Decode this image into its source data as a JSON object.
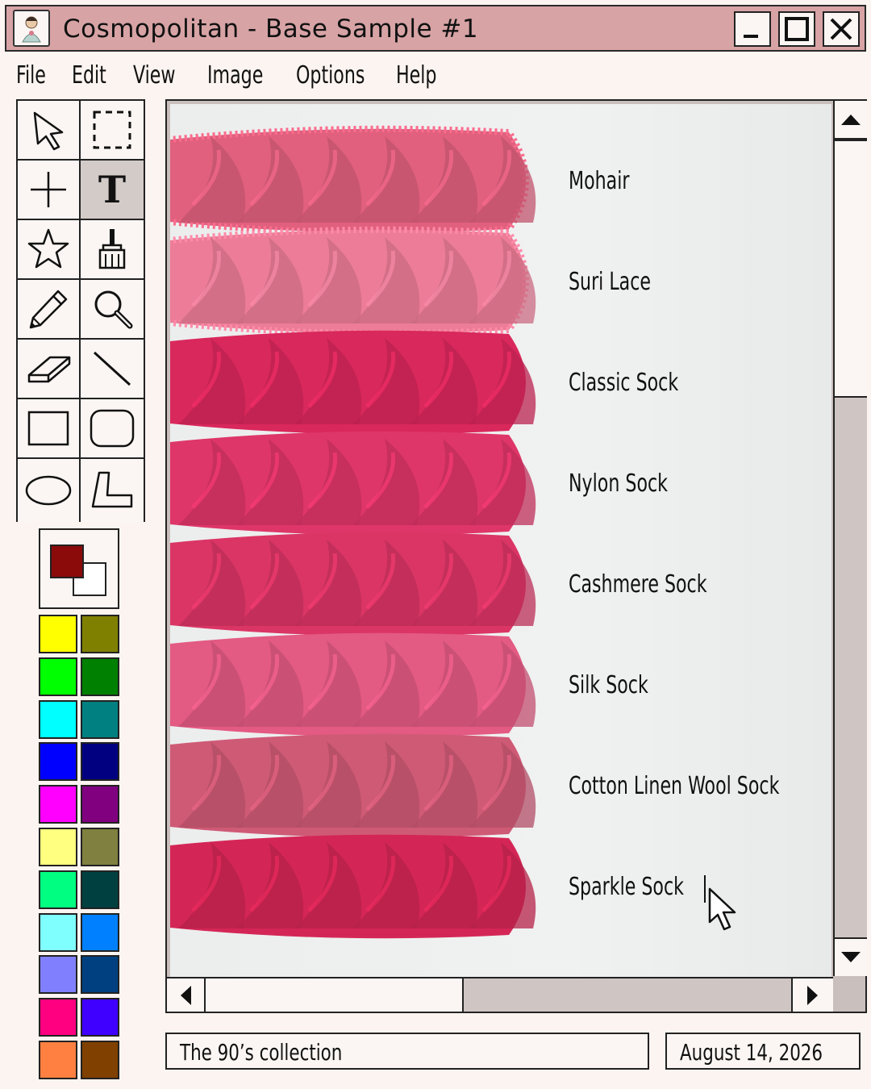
{
  "window": {
    "title": "Cosmopolitan - Base Sample #1",
    "buttons": [
      "minimize",
      "maximize",
      "close"
    ]
  },
  "menu": {
    "items": [
      "File",
      "Edit",
      "View",
      "Image",
      "Options",
      "Help"
    ]
  },
  "toolbox": {
    "tools": [
      {
        "name": "select-arrow",
        "icon": "arrow-cursor-icon"
      },
      {
        "name": "rect-select",
        "icon": "dashed-rectangle-icon"
      },
      {
        "name": "crosshair",
        "icon": "crosshair-icon"
      },
      {
        "name": "text",
        "icon": "text-icon",
        "glyph": "T",
        "active": true
      },
      {
        "name": "star",
        "icon": "star-icon"
      },
      {
        "name": "brush",
        "icon": "brush-icon"
      },
      {
        "name": "pencil",
        "icon": "pencil-icon"
      },
      {
        "name": "magnifier",
        "icon": "magnifier-icon"
      },
      {
        "name": "eraser",
        "icon": "eraser-icon"
      },
      {
        "name": "line",
        "icon": "line-icon"
      },
      {
        "name": "rectangle",
        "icon": "rectangle-icon"
      },
      {
        "name": "rounded-rectangle",
        "icon": "rounded-rectangle-icon"
      },
      {
        "name": "ellipse",
        "icon": "ellipse-icon"
      },
      {
        "name": "polygon",
        "icon": "polygon-icon"
      }
    ]
  },
  "colors": {
    "foreground": "#8b0a0a",
    "background": "#ffffff",
    "palette": [
      "#ffff00",
      "#808000",
      "#00ff00",
      "#008000",
      "#00ffff",
      "#008080",
      "#0000ff",
      "#000080",
      "#ff00ff",
      "#800080",
      "#ffff80",
      "#808040",
      "#00ff80",
      "#004040",
      "#80ffff",
      "#0080ff",
      "#8080ff",
      "#004080",
      "#ff0080",
      "#4000ff",
      "#ff8040",
      "#804000"
    ]
  },
  "canvas": {
    "yarns": [
      {
        "label": "Mohair",
        "color": "#e0607e",
        "fuzzy": true
      },
      {
        "label": "Suri Lace",
        "color": "#ec7c97",
        "fuzzy": true
      },
      {
        "label": "Classic Sock",
        "color": "#d9285c",
        "fuzzy": false
      },
      {
        "label": "Nylon Sock",
        "color": "#de3668",
        "fuzzy": false
      },
      {
        "label": "Cashmere Sock",
        "color": "#da3565",
        "fuzzy": false
      },
      {
        "label": "Silk Sock",
        "color": "#e35a82",
        "fuzzy": false
      },
      {
        "label": "Cotton Linen Wool Sock",
        "color": "#cf5a76",
        "fuzzy": false
      },
      {
        "label": "Sparkle Sock",
        "color": "#d42656",
        "fuzzy": false
      }
    ]
  },
  "status": {
    "collection": "The 90’s collection",
    "date": "August 14, 2026"
  }
}
